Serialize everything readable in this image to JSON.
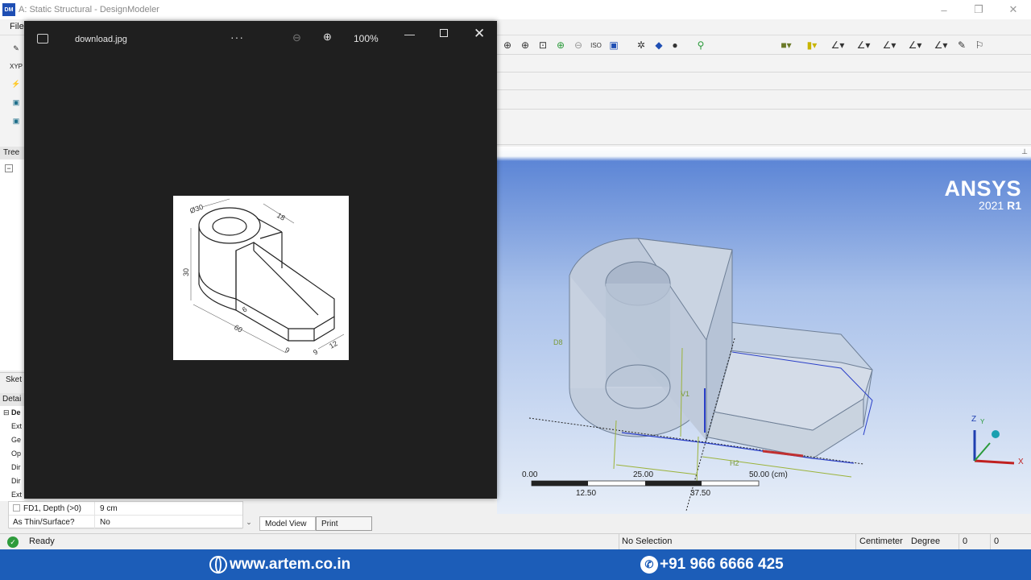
{
  "window": {
    "title": "A: Static Structural - DesignModeler",
    "app_icon": "DM",
    "menu_file": "File"
  },
  "left_panel": {
    "tree_header": "Tree O",
    "sketch_tab": "Sket",
    "details_header": "Detai",
    "details_group": "De",
    "detail_rows": [
      "Ext",
      "Ge",
      "Op",
      "Dir",
      "Dir",
      "Ext"
    ],
    "xy_label": "XYP"
  },
  "properties": [
    {
      "key": "FD1, Depth (>0)",
      "value": "9 cm"
    },
    {
      "key": "As Thin/Surface?",
      "value": "No"
    }
  ],
  "bottom_tabs": [
    "Model View",
    "Print Preview"
  ],
  "status": {
    "state": "Ready",
    "selection": "No Selection",
    "length_unit": "Centimeter",
    "angle_unit": "Degree",
    "count_a": "0",
    "count_b": "0"
  },
  "footer": {
    "website": "www.artem.co.in",
    "phone": "+91 966 6666 425"
  },
  "viewport": {
    "brand": "ANSYS",
    "version_year": "2021",
    "version_release": "R1",
    "scale_labels": [
      "0.00",
      "25.00",
      "50.00 (cm)",
      "12.50",
      "37.50"
    ],
    "dimension_labels": [
      "D8",
      "V1",
      "H2"
    ],
    "triad_axes": [
      "Z",
      "Y",
      "X"
    ]
  },
  "viewer": {
    "filename": "download.jpg",
    "zoom": "100%",
    "more": "···"
  },
  "drawing": {
    "dims": [
      "Ø30",
      "18",
      "30",
      "6",
      "60",
      "9",
      "9",
      "12"
    ]
  }
}
